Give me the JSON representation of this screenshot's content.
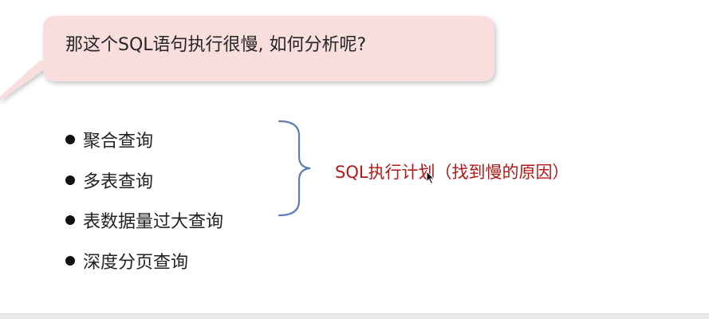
{
  "callout": {
    "text": "那这个SQL语句执行很慢, 如何分析呢?"
  },
  "bullets": [
    {
      "label": "聚合查询"
    },
    {
      "label": "多表查询"
    },
    {
      "label": "表数据量过大查询"
    },
    {
      "label": "深度分页查询"
    }
  ],
  "conclusion": {
    "text": "SQL执行计划（找到慢的原因）"
  },
  "colors": {
    "callout_fill": "#f8dedd",
    "conclusion_text": "#b21818",
    "brace_stroke": "#5b7fb3"
  }
}
